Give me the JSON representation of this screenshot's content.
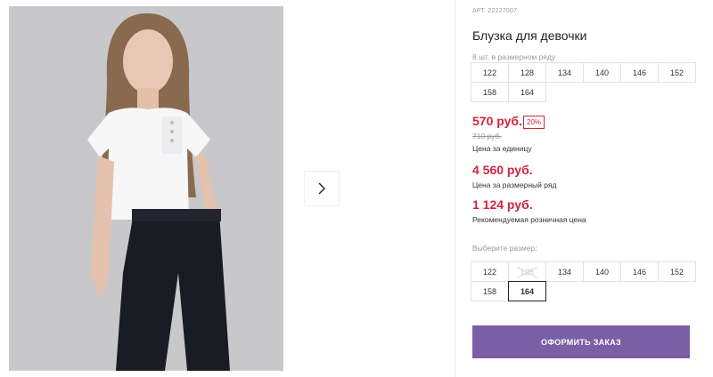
{
  "product": {
    "article": "АРТ. 22227007",
    "title": "Блузка для девочки",
    "sizes_caption": "8 шт. в размерном ряду",
    "row_sizes": [
      "122",
      "128",
      "134",
      "140",
      "146",
      "152",
      "158",
      "164"
    ]
  },
  "pricing": {
    "unit_price": "570 руб.",
    "discount": "20%",
    "old_price": "710 руб.",
    "unit_caption": "Цена за единицу",
    "row_price": "4 560 руб.",
    "row_caption": "Цена за размерный ряд",
    "retail_price": "1 124 руб.",
    "retail_caption": "Рекомендуемая розничная цена"
  },
  "size_select": {
    "label": "Выберите размер:",
    "options": [
      {
        "label": "122",
        "state": "available"
      },
      {
        "label": "128",
        "state": "disabled"
      },
      {
        "label": "134",
        "state": "available"
      },
      {
        "label": "140",
        "state": "available"
      },
      {
        "label": "146",
        "state": "available"
      },
      {
        "label": "152",
        "state": "available"
      },
      {
        "label": "158",
        "state": "available"
      },
      {
        "label": "164",
        "state": "selected"
      }
    ]
  },
  "actions": {
    "order_label": "ОФОРМИТЬ ЗАКАЗ"
  },
  "colors": {
    "price_red": "#d0253e",
    "button_purple": "#7a5fa6"
  },
  "icons": {
    "next": "chevron-right-icon"
  }
}
